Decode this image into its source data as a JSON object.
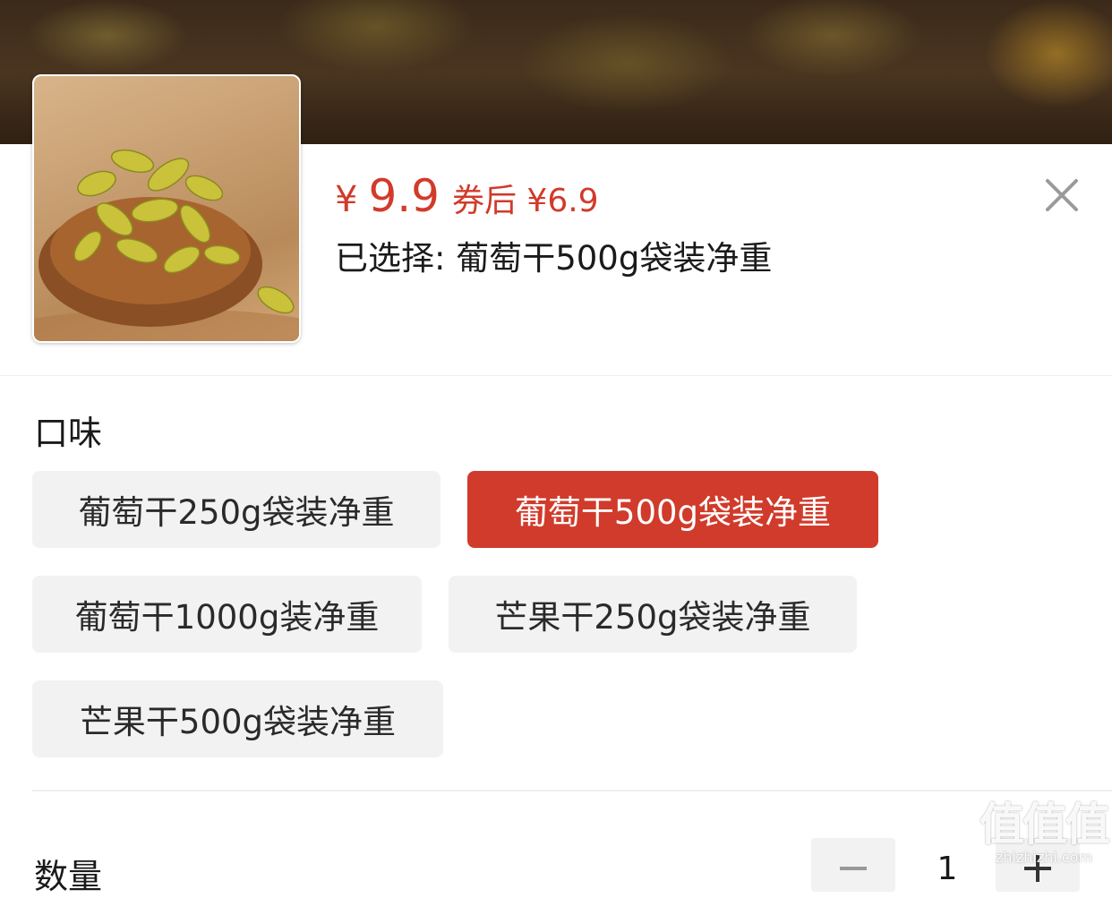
{
  "product": {
    "price_symbol": "¥",
    "price": "9.9",
    "coupon_price": "券后 ¥6.9",
    "selected_text": "已选择: 葡萄干500g袋装净重"
  },
  "flavor": {
    "title": "口味",
    "options": [
      {
        "label": "葡萄干250g袋装净重",
        "selected": false
      },
      {
        "label": "葡萄干500g袋装净重",
        "selected": true
      },
      {
        "label": "葡萄干1000g装净重",
        "selected": false
      },
      {
        "label": "芒果干250g袋装净重",
        "selected": false
      },
      {
        "label": "芒果干500g袋装净重",
        "selected": false
      }
    ]
  },
  "quantity": {
    "label": "数量",
    "value": "1"
  },
  "watermark": {
    "big": "值值值",
    "small": "zhizhizhi.com"
  },
  "colors": {
    "accent": "#d03b2b",
    "option_bg": "#f2f2f2"
  },
  "icons": [
    "close-icon",
    "minus-icon",
    "plus-icon"
  ]
}
